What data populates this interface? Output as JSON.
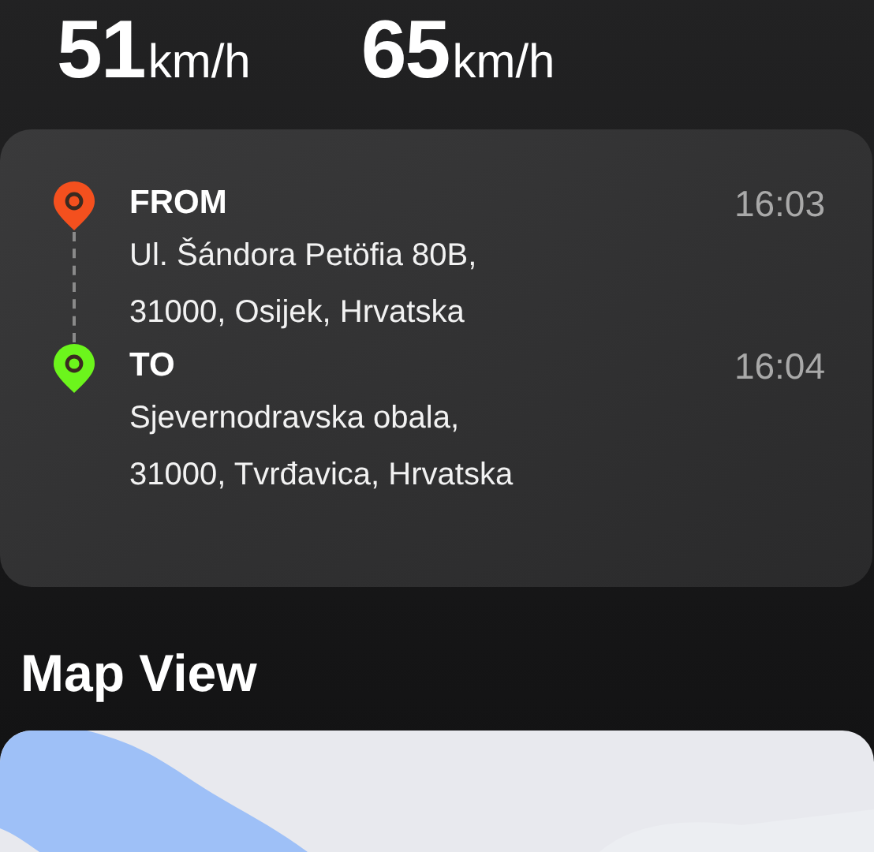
{
  "speeds": [
    {
      "value": "51",
      "unit": "km/h"
    },
    {
      "value": "65",
      "unit": "km/h"
    }
  ],
  "route": {
    "stops": [
      {
        "label": "FROM",
        "time": "16:03",
        "color": "#f4501e",
        "address": [
          "Ul. Šándora Petöfia 80B,",
          "31000, Osijek, Hrvatska"
        ]
      },
      {
        "label": "TO",
        "time": "16:04",
        "color": "#6cf51c",
        "address": [
          "Sjevernodravska obala,",
          "31000, Tvrđavica, Hrvatska"
        ]
      }
    ]
  },
  "map": {
    "title": "Map View",
    "kind": "picture"
  }
}
